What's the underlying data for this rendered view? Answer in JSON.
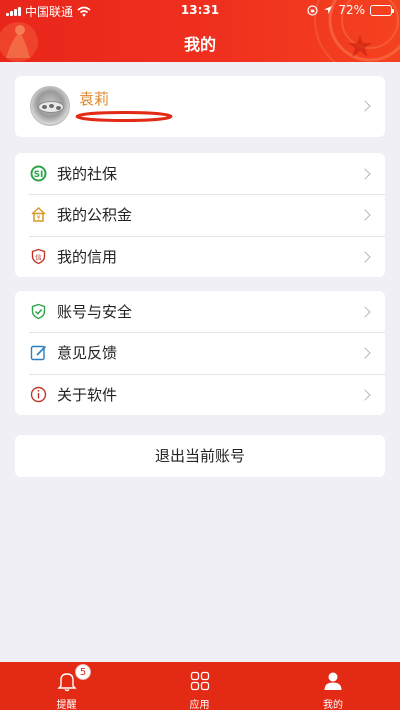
{
  "status_bar": {
    "carrier": "中国联通",
    "time": "13:31",
    "battery": "72%",
    "battery_level": 0.72
  },
  "header": {
    "title": "我的"
  },
  "profile": {
    "name": "袁莉"
  },
  "menu_group_1": [
    {
      "label": "我的社保",
      "icon": "social-security-icon"
    },
    {
      "label": "我的公积金",
      "icon": "housing-fund-icon"
    },
    {
      "label": "我的信用",
      "icon": "credit-shield-icon"
    }
  ],
  "menu_group_2": [
    {
      "label": "账号与安全",
      "icon": "security-shield-icon"
    },
    {
      "label": "意见反馈",
      "icon": "feedback-edit-icon"
    },
    {
      "label": "关于软件",
      "icon": "info-icon"
    }
  ],
  "logout_label": "退出当前账号",
  "tabbar": {
    "tabs": [
      {
        "label": "提醒",
        "icon": "bell-icon",
        "badge": "5"
      },
      {
        "label": "应用",
        "icon": "apps-grid-icon"
      },
      {
        "label": "我的",
        "icon": "user-icon"
      }
    ]
  },
  "colors": {
    "brand_red": "#e32a15",
    "name_orange": "#e0872a",
    "background": "#f0eff5"
  }
}
